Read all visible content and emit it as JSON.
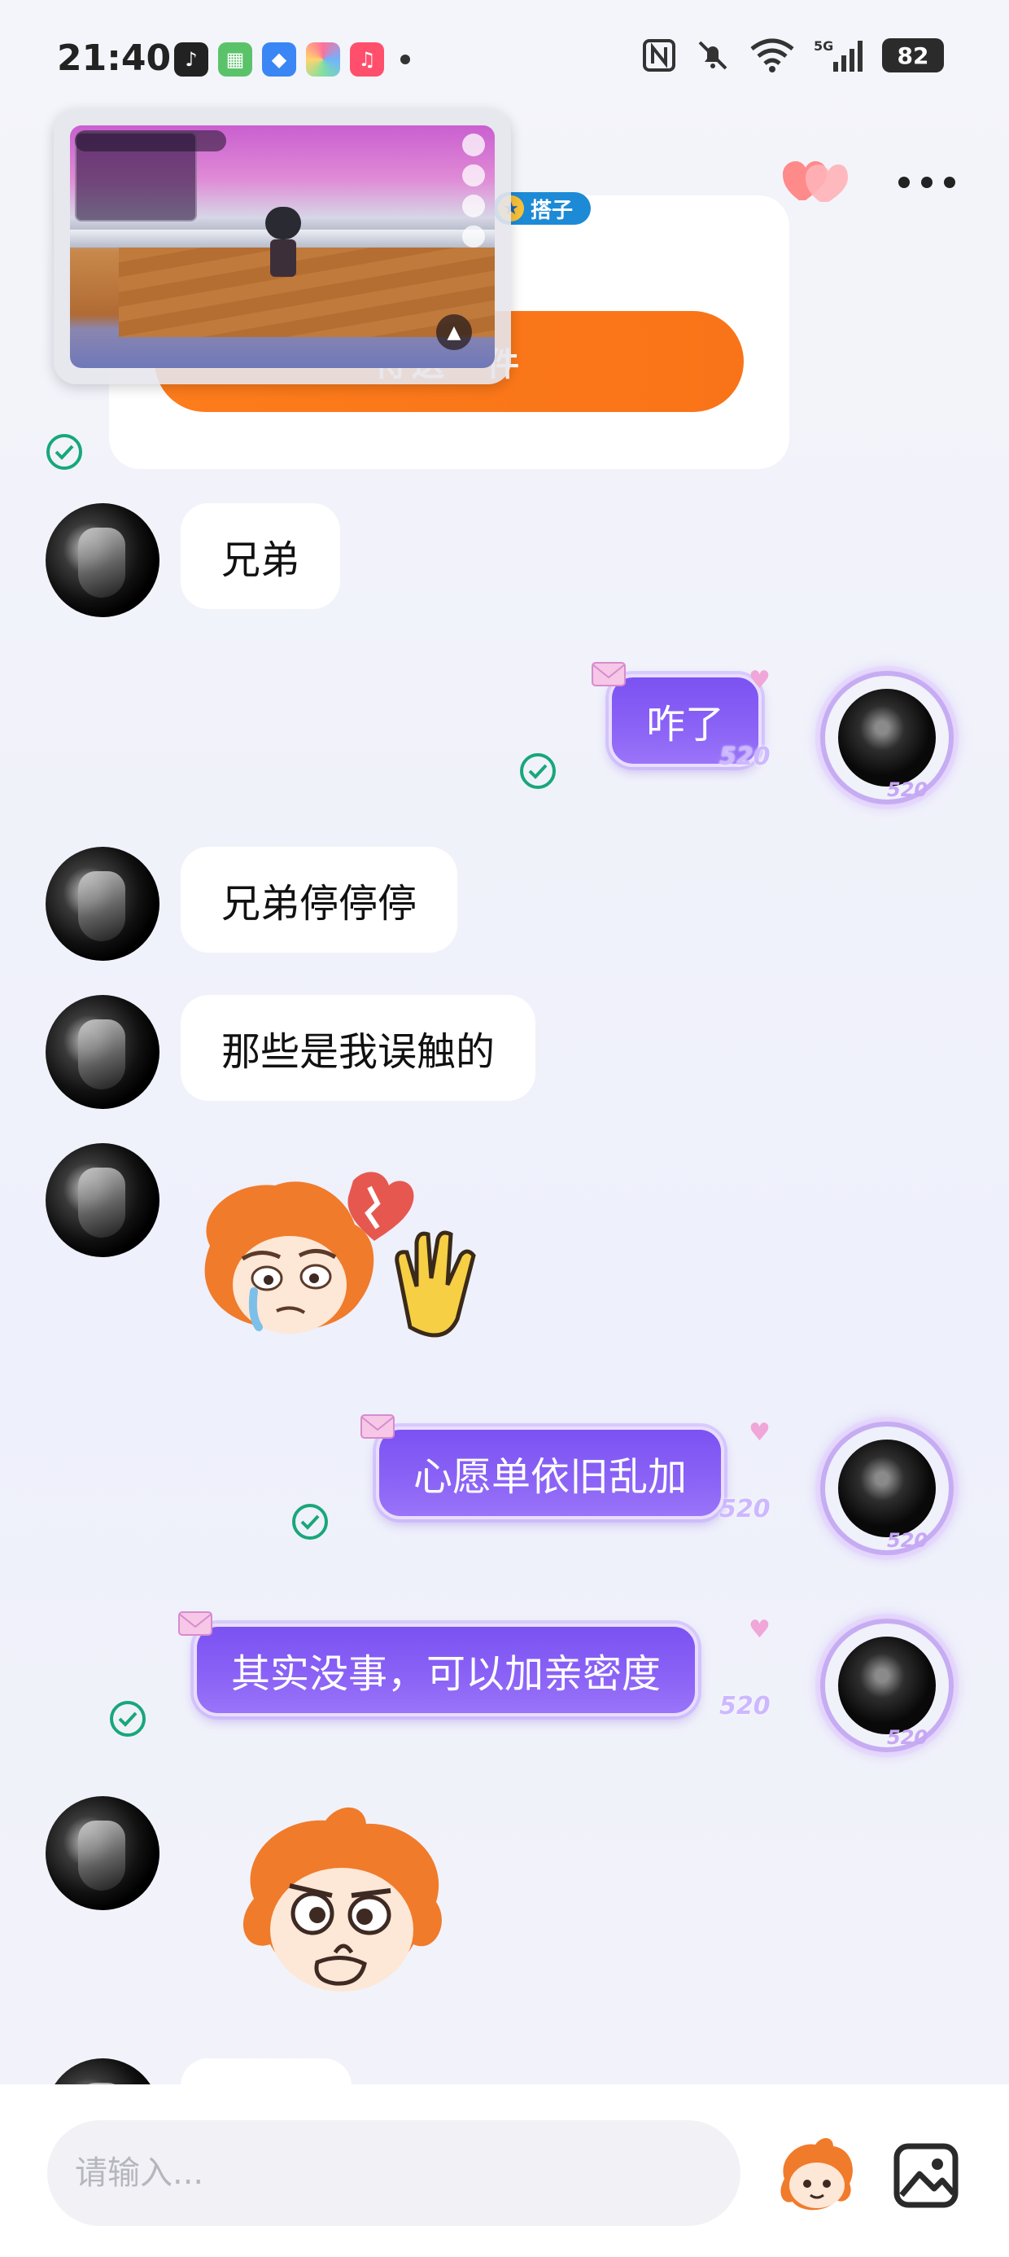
{
  "status_bar": {
    "time": "21:40",
    "battery": "82",
    "icons": [
      "tiktok-icon",
      "green-app-icon",
      "blue-app-icon",
      "multicolor-app-icon",
      "music-app-icon",
      "nfc-icon",
      "mute-icon",
      "wifi-icon",
      "5g-signal-icon",
      "battery-icon"
    ]
  },
  "header": {
    "icons": [
      "heart-icon",
      "more-icon"
    ]
  },
  "shared_card": {
    "tag": "搭子",
    "button_label": "待送一件"
  },
  "messages": [
    {
      "side": "left",
      "type": "text",
      "text": "兄弟"
    },
    {
      "side": "right",
      "type": "text",
      "text": "咋了",
      "badge": "520",
      "status": "read"
    },
    {
      "side": "left",
      "type": "text",
      "text": "兄弟停停停"
    },
    {
      "side": "left",
      "type": "text",
      "text": "那些是我误触的"
    },
    {
      "side": "left",
      "type": "sticker",
      "sticker": "crying-wave-sticker"
    },
    {
      "side": "right",
      "type": "text",
      "text": "心愿单依旧乱加",
      "badge": "520",
      "status": "read"
    },
    {
      "side": "right",
      "type": "text",
      "text": "其实没事，可以加亲密度",
      "badge": "520",
      "status": "read"
    },
    {
      "side": "left",
      "type": "sticker",
      "sticker": "thinking-sticker"
    }
  ],
  "input": {
    "placeholder": "请输入..."
  },
  "colors": {
    "accent_orange": "#f97418",
    "bubble_purple": "#7b52f2",
    "check_green": "#18a77a"
  }
}
